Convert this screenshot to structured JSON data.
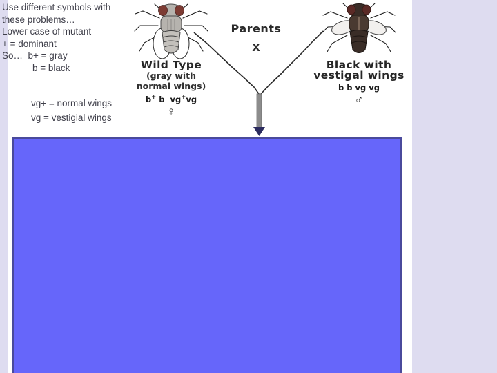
{
  "slide": {
    "background_color": "#dedcf0",
    "panel_color": "#ffffff",
    "text_color": "#3f3f4a"
  },
  "notes": {
    "line1": "Use different symbols with",
    "line2": "these problems…",
    "line3": "Lower case of mutant",
    "line4": "+ = dominant",
    "line5_prefix": "So…",
    "line5_value": "b+ = gray",
    "line6_value": "b   = black"
  },
  "vg_notes": {
    "line1": "vg+ = normal wings",
    "line2": "vg = vestigial wings"
  },
  "cross": {
    "parents_label": "Parents",
    "cross_symbol": "X",
    "arrow_color": "#8c8c8c",
    "left_parent": {
      "name": "Wild Type",
      "sub_line1": "(gray with",
      "sub_line2": "normal wings)",
      "genotype_plain": "b+ b  vg+ vg",
      "genotype_parts": [
        "b",
        "+",
        " b  vg",
        "+",
        " vg"
      ],
      "sex": "♀",
      "sex_name": "female",
      "fly_color": "#b6b3ae",
      "eye_color": "#7d3b33"
    },
    "right_parent": {
      "name": "Black with",
      "name_line2": "vestigal wings",
      "genotype_plain": "b b vg vg",
      "sex": "♂",
      "sex_name": "male",
      "fly_color": "#3a2d27",
      "eye_color": "#5b2a26"
    }
  },
  "blue_box": {
    "fill_color": "#6666fa",
    "border_color": "#4a4a9c",
    "content": ""
  }
}
